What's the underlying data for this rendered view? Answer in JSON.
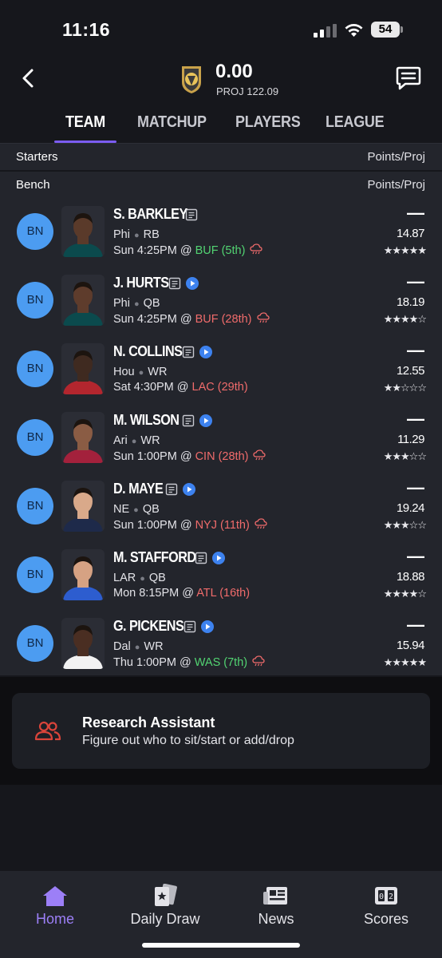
{
  "status": {
    "time": "11:16",
    "battery": "54"
  },
  "header": {
    "score": "0.00",
    "proj": "PROJ 122.09"
  },
  "tabs": [
    "TEAM",
    "MATCHUP",
    "PLAYERS",
    "LEAGUE"
  ],
  "sections": {
    "starters": {
      "label": "Starters",
      "right": "Points/Proj"
    },
    "bench": {
      "label": "Bench",
      "right": "Points/Proj"
    }
  },
  "players": [
    {
      "slot": "BN",
      "name": "S. BARKLEY",
      "team": "Phi",
      "pos": "RB",
      "game": "Sun 4:25PM @ ",
      "opp": "BUF (5th)",
      "opp_tone": "good",
      "points": "—",
      "proj": "14.87",
      "stars": 5,
      "weather": true,
      "video": false,
      "skin": "#5a3a2a",
      "jersey": "#0b4a4d"
    },
    {
      "slot": "BN",
      "name": "J. HURTS",
      "team": "Phi",
      "pos": "QB",
      "game": "Sun 4:25PM @ ",
      "opp": "BUF (28th)",
      "opp_tone": "bad",
      "points": "—",
      "proj": "18.19",
      "stars": 4,
      "weather": true,
      "video": true,
      "skin": "#5e3c2c",
      "jersey": "#0b4a4d"
    },
    {
      "slot": "BN",
      "name": "N. COLLINS",
      "team": "Hou",
      "pos": "WR",
      "game": "Sat 4:30PM @ ",
      "opp": "LAC (29th)",
      "opp_tone": "bad",
      "points": "—",
      "proj": "12.55",
      "stars": 2,
      "weather": false,
      "video": true,
      "skin": "#3f2a20",
      "jersey": "#b3262e"
    },
    {
      "slot": "BN",
      "name": "M. WILSON",
      "team": "Ari",
      "pos": "WR",
      "game": "Sun 1:00PM @ ",
      "opp": "CIN (28th)",
      "opp_tone": "bad",
      "points": "—",
      "proj": "11.29",
      "stars": 3,
      "weather": true,
      "video": true,
      "skin": "#8a5c44",
      "jersey": "#a3213c"
    },
    {
      "slot": "BN",
      "name": "D. MAYE",
      "team": "NE",
      "pos": "QB",
      "game": "Sun 1:00PM @ ",
      "opp": "NYJ (11th)",
      "opp_tone": "bad",
      "points": "—",
      "proj": "19.24",
      "stars": 3,
      "weather": true,
      "video": true,
      "skin": "#d9a98a",
      "jersey": "#1e2a4a"
    },
    {
      "slot": "BN",
      "name": "M. STAFFORD",
      "team": "LAR",
      "pos": "QB",
      "game": "Mon 8:15PM @ ",
      "opp": "ATL (16th)",
      "opp_tone": "bad",
      "points": "—",
      "proj": "18.88",
      "stars": 4,
      "weather": false,
      "video": true,
      "skin": "#d6a283",
      "jersey": "#2d5dcf"
    },
    {
      "slot": "BN",
      "name": "G. PICKENS",
      "team": "Dal",
      "pos": "WR",
      "game": "Thu 1:00PM @ ",
      "opp": "WAS (7th)",
      "opp_tone": "good",
      "points": "—",
      "proj": "15.94",
      "stars": 5,
      "weather": true,
      "video": true,
      "skin": "#4a2e22",
      "jersey": "#f2f2f2"
    }
  ],
  "research": {
    "title": "Research Assistant",
    "subtitle": "Figure out who to sit/start or add/drop"
  },
  "nav": [
    {
      "label": "Home",
      "icon": "home-icon",
      "active": true
    },
    {
      "label": "Daily Draw",
      "icon": "daily-draw-icon",
      "active": false
    },
    {
      "label": "News",
      "icon": "news-icon",
      "active": false
    },
    {
      "label": "Scores",
      "icon": "scores-icon",
      "active": false
    }
  ],
  "colors": {
    "accent": "#7b5cf2",
    "slot_badge": "#4c9cf1",
    "good": "#52d472",
    "bad": "#f06b6b"
  }
}
